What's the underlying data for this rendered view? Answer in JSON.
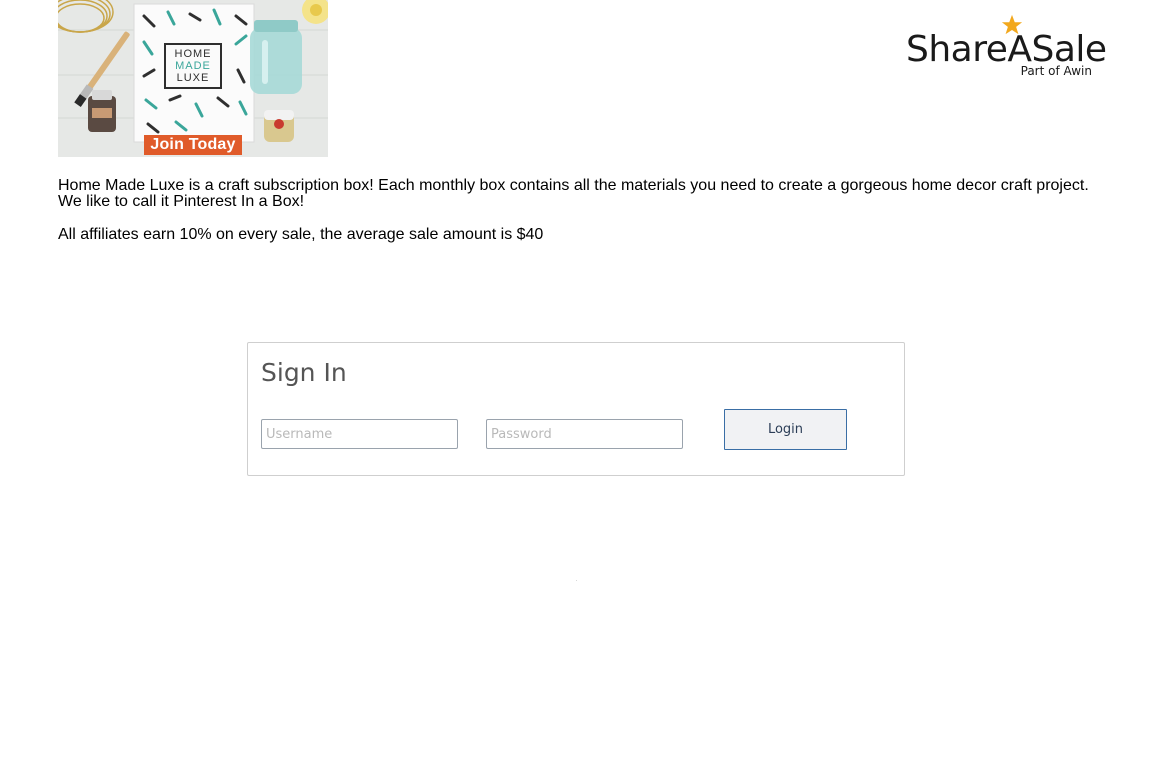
{
  "banner": {
    "box_label_lines": [
      "HOME",
      "MADE",
      "LUXE"
    ],
    "cta": "Join Today"
  },
  "logo": {
    "wordmark": "ShareASale",
    "tagline": "Part of Awin",
    "star_color": "#f2a81d"
  },
  "merchant": {
    "description": "Home Made Luxe is a craft subscription box! Each monthly box contains all the materials you need to create a gorgeous home decor craft project. We like to call it Pinterest In a Box!",
    "commission": "All affiliates earn 10% on every sale, the average sale amount is $40"
  },
  "signin": {
    "title": "Sign In",
    "username_placeholder": "Username",
    "password_placeholder": "Password",
    "login_label": "Login"
  },
  "colors": {
    "cta_orange": "#e05b2a",
    "login_border": "#3a6ea5",
    "panel_border": "#cfcfcf"
  }
}
